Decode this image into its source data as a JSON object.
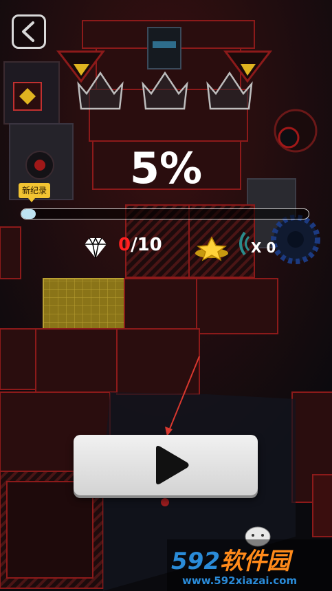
{
  "hud": {
    "progress_text": "5%",
    "progress_fraction": 0.05,
    "best_record_label": "新纪录",
    "gems_collected": "0",
    "gems_total": "/10",
    "revive_count": "X 0"
  },
  "crowns": {
    "earned": 0,
    "total": 3
  },
  "play_button": {
    "icon": "play-icon"
  },
  "watermark": {
    "logo_number": "592",
    "logo_text": "软件园",
    "url": "www.592xiazai.com"
  },
  "colors": {
    "accent_red": "#ff2020",
    "progress_fill": "#bfe4f2",
    "tag_yellow": "#f2c432",
    "tile_outline": "#8c1a1a",
    "tile_fill": "#2a0d0e",
    "highlight_tile": "#8a7a1a"
  }
}
